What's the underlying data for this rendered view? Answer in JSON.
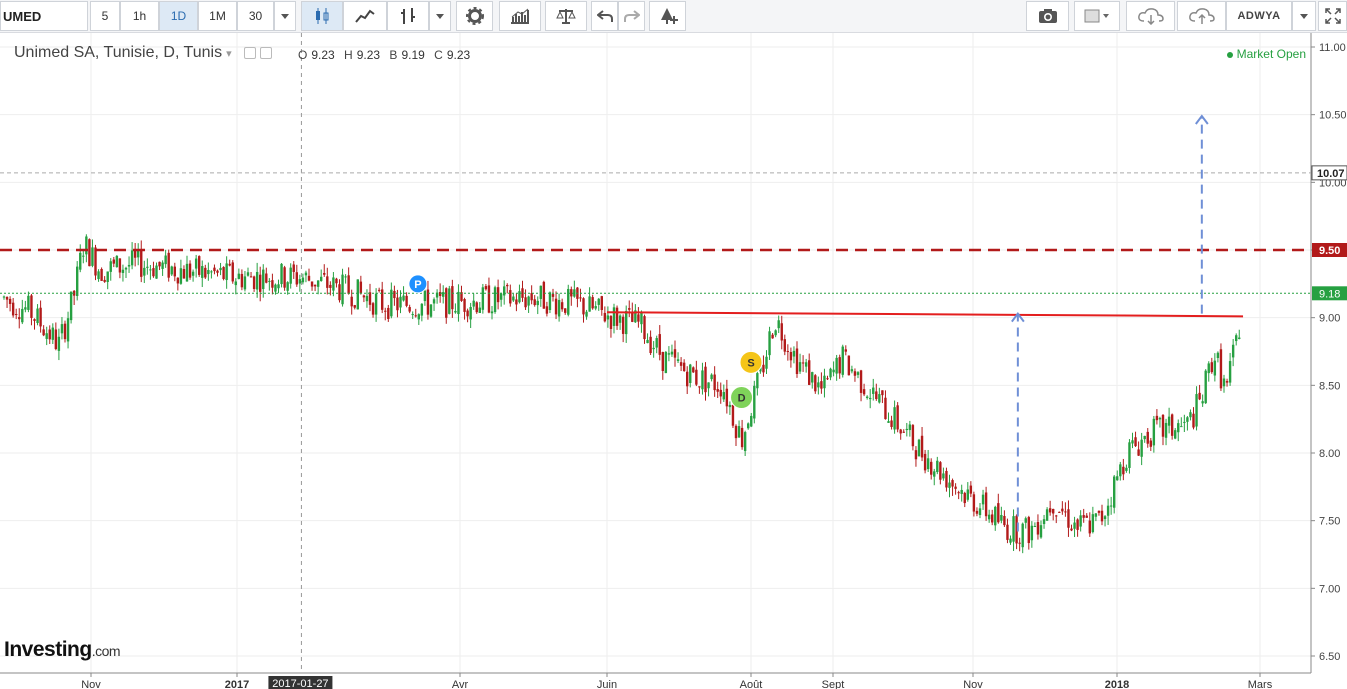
{
  "toolbar": {
    "symbol": "UMED",
    "intervals": [
      "5",
      "1h",
      "1D",
      "1M",
      "30"
    ],
    "active_interval": "1D",
    "right_label": "ADWYA",
    "icons": [
      "candles-icon",
      "area-icon",
      "bars-icon",
      "caret-down-icon",
      "gear-icon",
      "indicators-icon",
      "compare-icon",
      "undo-icon",
      "redo-icon",
      "alert-icon",
      "camera-icon",
      "color-box-icon",
      "cloud-download-icon",
      "cloud-upload-icon",
      "fullscreen-icon"
    ]
  },
  "legend": {
    "title": "Unimed SA, Tunisie, D, Tunis",
    "ohlc": [
      {
        "k": "O",
        "v": "9.23"
      },
      {
        "k": "H",
        "v": "9.23"
      },
      {
        "k": "B",
        "v": "9.19"
      },
      {
        "k": "C",
        "v": "9.23"
      }
    ],
    "status": "Market Open"
  },
  "brand": {
    "name": "Investing",
    "suffix": ".com"
  },
  "colors": {
    "up": "#26a041",
    "down": "#b21a1a",
    "resistance": "#b21a1a",
    "neckline": "#e31e1e",
    "projection": "#6f8fd6",
    "last_price": "#26a041",
    "grid": "#eeeeee"
  },
  "chart_data": {
    "type": "candlestick",
    "ylim": [
      6.5,
      11.0
    ],
    "yticks": [
      "6.50",
      "7.00",
      "7.50",
      "8.00",
      "8.50",
      "9.00",
      "9.50",
      "10.00",
      "10.50",
      "11.00"
    ],
    "xlabels": [
      "Nov",
      "2017",
      "Avr",
      "Juin",
      "Août",
      "Sept",
      "Nov",
      "2018",
      "Mars"
    ],
    "crosshair_date": "2017-01-27",
    "levels": [
      {
        "value": 10.07,
        "label": "10.07",
        "style": "grey-dashed"
      },
      {
        "value": 9.5,
        "label": "9.50",
        "style": "resistance"
      },
      {
        "value": 9.18,
        "label": "9.18",
        "style": "last-price"
      }
    ],
    "neckline": {
      "from": {
        "date": "2017-06-01",
        "value": 9.04
      },
      "to": {
        "date": "2018-02-22",
        "value": 9.01
      }
    },
    "projections": [
      {
        "date": "2017-11-20",
        "from": 7.42,
        "to": 9.03
      },
      {
        "date": "2018-02-05",
        "from": 9.03,
        "to": 10.49
      }
    ],
    "markers": [
      {
        "label": "P",
        "date": "2017-03-15",
        "value": 9.25,
        "color": "#1e90ff"
      },
      {
        "label": "S",
        "date": "2017-08-01",
        "value": 8.67,
        "color": "#f5c518"
      },
      {
        "label": "D",
        "date": "2017-07-28",
        "value": 8.41,
        "color": "#7fd35a"
      }
    ],
    "path": [
      [
        "2016-09-01",
        9.15
      ],
      [
        "2016-09-20",
        9.05
      ],
      [
        "2016-10-10",
        8.8
      ],
      [
        "2016-10-20",
        9.15
      ],
      [
        "2016-10-27",
        9.55
      ],
      [
        "2016-11-05",
        9.35
      ],
      [
        "2016-11-20",
        9.4
      ],
      [
        "2016-12-10",
        9.35
      ],
      [
        "2016-12-31",
        9.3
      ],
      [
        "2017-01-15",
        9.3
      ],
      [
        "2017-01-27",
        9.3
      ],
      [
        "2017-02-15",
        9.2
      ],
      [
        "2017-03-01",
        9.1
      ],
      [
        "2017-03-20",
        9.1
      ],
      [
        "2017-04-05",
        9.12
      ],
      [
        "2017-05-01",
        9.15
      ],
      [
        "2017-05-20",
        9.1
      ],
      [
        "2017-06-01",
        9.02
      ],
      [
        "2017-06-15",
        8.95
      ],
      [
        "2017-06-25",
        8.7
      ],
      [
        "2017-07-10",
        8.55
      ],
      [
        "2017-07-20",
        8.5
      ],
      [
        "2017-07-28",
        8.1
      ],
      [
        "2017-08-05",
        8.6
      ],
      [
        "2017-08-10",
        9.0
      ],
      [
        "2017-08-18",
        8.7
      ],
      [
        "2017-08-28",
        8.45
      ],
      [
        "2017-09-05",
        8.7
      ],
      [
        "2017-09-15",
        8.5
      ],
      [
        "2017-09-25",
        8.3
      ],
      [
        "2017-10-10",
        8.0
      ],
      [
        "2017-10-25",
        7.75
      ],
      [
        "2017-11-05",
        7.6
      ],
      [
        "2017-11-15",
        7.45
      ],
      [
        "2017-11-25",
        7.42
      ],
      [
        "2017-12-05",
        7.65
      ],
      [
        "2017-12-15",
        7.45
      ],
      [
        "2017-12-25",
        7.5
      ],
      [
        "2018-01-05",
        8.0
      ],
      [
        "2018-01-15",
        8.15
      ],
      [
        "2018-01-30",
        8.2
      ],
      [
        "2018-02-05",
        8.4
      ],
      [
        "2018-02-10",
        8.75
      ],
      [
        "2018-02-15",
        8.45
      ],
      [
        "2018-02-20",
        8.9
      ],
      [
        "2018-02-26",
        9.18
      ]
    ]
  }
}
